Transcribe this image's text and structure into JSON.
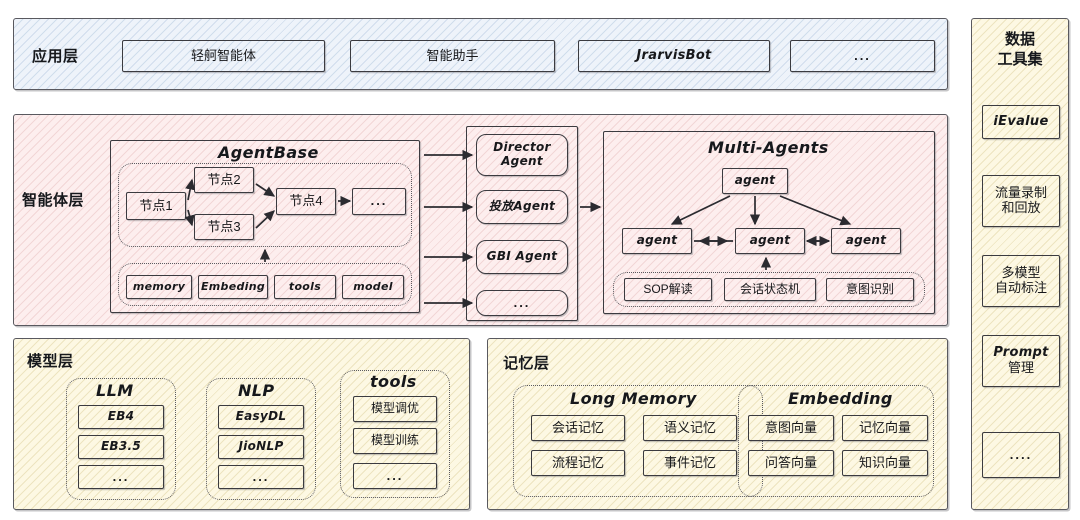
{
  "application_layer": {
    "label": "应用层",
    "items": [
      {
        "label": "轻舸智能体"
      },
      {
        "label": "智能助手"
      },
      {
        "label": "JrarvisBot"
      },
      {
        "label": "..."
      }
    ]
  },
  "agent_layer": {
    "label": "智能体层",
    "agent_base": {
      "title": "AgentBase",
      "nodes": [
        {
          "label": "节点1"
        },
        {
          "label": "节点2"
        },
        {
          "label": "节点3"
        },
        {
          "label": "节点4"
        },
        {
          "label": "..."
        }
      ],
      "capabilities": [
        {
          "label": "memory"
        },
        {
          "label": "Embeding"
        },
        {
          "label": "tools"
        },
        {
          "label": "model"
        }
      ]
    },
    "agents": [
      {
        "label": "Director Agent"
      },
      {
        "label": "投放Agent"
      },
      {
        "label": "GBI Agent"
      },
      {
        "label": "..."
      }
    ],
    "multi_agents": {
      "title": "Multi-Agents",
      "root": {
        "label": "agent"
      },
      "children": [
        {
          "label": "agent"
        },
        {
          "label": "agent"
        },
        {
          "label": "agent"
        }
      ],
      "modules": [
        {
          "label": "SOP解读"
        },
        {
          "label": "会话状态机"
        },
        {
          "label": "意图识别"
        }
      ]
    }
  },
  "model_layer": {
    "label": "模型层",
    "groups": [
      {
        "title": "LLM",
        "items": [
          {
            "label": "EB4"
          },
          {
            "label": "EB3.5"
          },
          {
            "label": "..."
          }
        ]
      },
      {
        "title": "NLP",
        "items": [
          {
            "label": "EasyDL"
          },
          {
            "label": "JioNLP"
          },
          {
            "label": "..."
          }
        ]
      },
      {
        "title": "tools",
        "items": [
          {
            "label": "模型调优"
          },
          {
            "label": "模型训练"
          },
          {
            "label": "..."
          }
        ]
      }
    ]
  },
  "memory_layer": {
    "label": "记忆层",
    "groups": [
      {
        "title": "Long Memory",
        "items": [
          {
            "label": "会话记忆"
          },
          {
            "label": "语义记忆"
          },
          {
            "label": "流程记忆"
          },
          {
            "label": "事件记忆"
          }
        ]
      },
      {
        "title": "Embedding",
        "items": [
          {
            "label": "意图向量"
          },
          {
            "label": "记忆向量"
          },
          {
            "label": "问答向量"
          },
          {
            "label": "知识向量"
          }
        ]
      }
    ]
  },
  "data_tools_panel": {
    "title_line1": "数据",
    "title_line2": "工具集",
    "items": [
      {
        "label": "iEvalue"
      },
      {
        "label": "流量录制\n和回放",
        "line1": "流量录制",
        "line2": "和回放"
      },
      {
        "label": "多模型\n自动标注",
        "line1": "多模型",
        "line2": "自动标注"
      },
      {
        "label": "Prompt\n管理",
        "line1": "Prompt",
        "line2": "管理"
      },
      {
        "label": "...."
      }
    ]
  },
  "colors": {
    "application_layer_fill": "#eef3fa",
    "agent_layer_fill": "#fdeeee",
    "model_layer_fill": "#fdf8e3",
    "memory_layer_fill": "#fdf8e3",
    "data_tools_fill": "#fdf8e3",
    "stroke": "#3b3b40"
  }
}
